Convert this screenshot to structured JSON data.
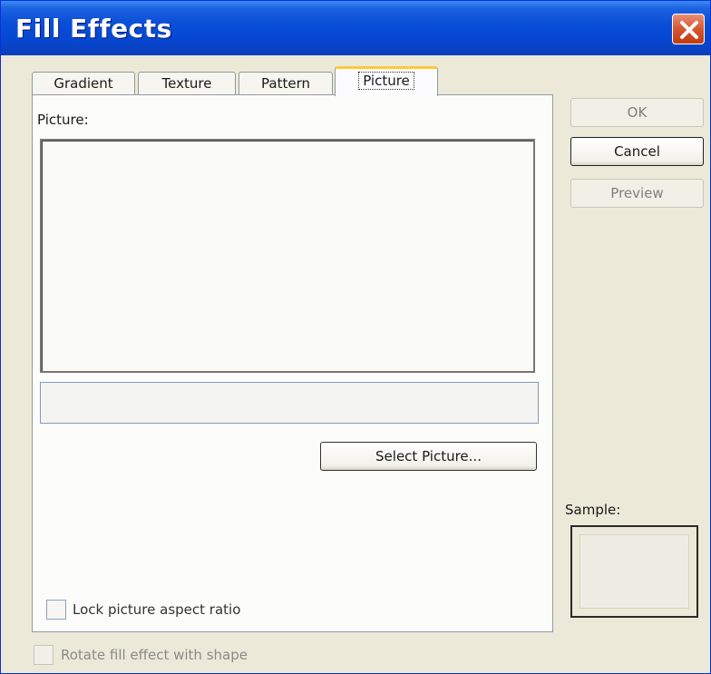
{
  "window": {
    "title": "Fill Effects"
  },
  "tabs": [
    {
      "label": "Gradient"
    },
    {
      "label": "Texture"
    },
    {
      "label": "Pattern"
    },
    {
      "label": "Picture",
      "active": true
    }
  ],
  "picture_tab": {
    "picture_label": "Picture:",
    "picture_name_value": "",
    "select_button": "Select Picture...",
    "lock_aspect_label": "Lock picture aspect ratio",
    "lock_aspect_checked": false
  },
  "buttons": {
    "ok": "OK",
    "cancel": "Cancel",
    "preview": "Preview"
  },
  "sample": {
    "label": "Sample:"
  },
  "rotate": {
    "label": "Rotate fill effect with shape",
    "checked": false
  },
  "colors": {
    "titlebar": "#0a4fd8",
    "tab_highlight": "#ffc83c",
    "dialog_bg": "#ece9d8"
  }
}
